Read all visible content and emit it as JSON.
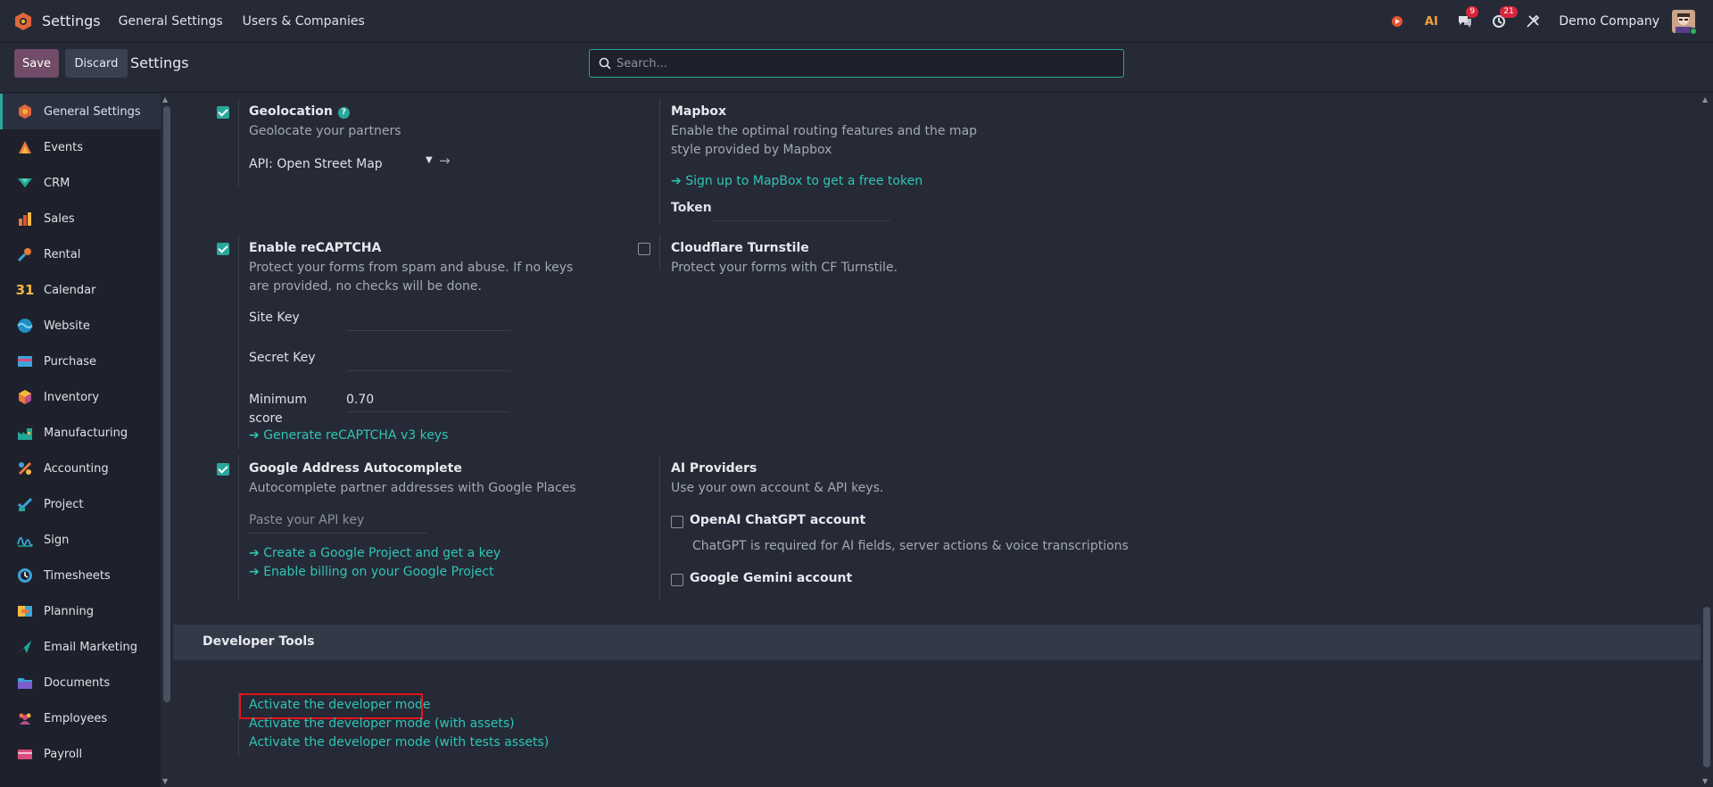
{
  "navbar": {
    "app_name": "Settings",
    "menus": [
      "General Settings",
      "Users & Companies"
    ],
    "ai_label": "AI",
    "messages_count": "9",
    "activities_count": "21",
    "company": "Demo Company"
  },
  "control_panel": {
    "save_label": "Save",
    "discard_label": "Discard",
    "title": "Settings",
    "search_placeholder": "Search..."
  },
  "sidebar": {
    "items": [
      {
        "label": "General Settings",
        "icon": "general-settings-icon",
        "active": true
      },
      {
        "label": "Events",
        "icon": "events-icon"
      },
      {
        "label": "CRM",
        "icon": "crm-icon"
      },
      {
        "label": "Sales",
        "icon": "sales-icon"
      },
      {
        "label": "Rental",
        "icon": "rental-icon"
      },
      {
        "label": "Calendar",
        "icon": "calendar-icon"
      },
      {
        "label": "Website",
        "icon": "website-icon"
      },
      {
        "label": "Purchase",
        "icon": "purchase-icon"
      },
      {
        "label": "Inventory",
        "icon": "inventory-icon"
      },
      {
        "label": "Manufacturing",
        "icon": "manufacturing-icon"
      },
      {
        "label": "Accounting",
        "icon": "accounting-icon"
      },
      {
        "label": "Project",
        "icon": "project-icon"
      },
      {
        "label": "Sign",
        "icon": "sign-icon"
      },
      {
        "label": "Timesheets",
        "icon": "timesheets-icon"
      },
      {
        "label": "Planning",
        "icon": "planning-icon"
      },
      {
        "label": "Email Marketing",
        "icon": "email-marketing-icon"
      },
      {
        "label": "Documents",
        "icon": "documents-icon"
      },
      {
        "label": "Employees",
        "icon": "employees-icon"
      },
      {
        "label": "Payroll",
        "icon": "payroll-icon"
      }
    ]
  },
  "settings": {
    "geolocation": {
      "title": "Geolocation",
      "desc": "Geolocate your partners",
      "api_value": "API: Open Street Map",
      "checked": true
    },
    "mapbox": {
      "title": "Mapbox",
      "desc": "Enable the optimal routing features and the map style provided by Mapbox",
      "link": "Sign up to MapBox to get a free token",
      "token_label": "Token"
    },
    "recaptcha": {
      "title": "Enable reCAPTCHA",
      "desc": "Protect your forms from spam and abuse. If no keys are provided, no checks will be done.",
      "site_key_label": "Site Key",
      "secret_key_label": "Secret Key",
      "min_score_label": "Minimum score",
      "min_score_value": "0.70",
      "link": "Generate reCAPTCHA v3 keys",
      "checked": true
    },
    "turnstile": {
      "title": "Cloudflare Turnstile",
      "desc": "Protect your forms with CF Turnstile.",
      "checked": false
    },
    "google_autocomplete": {
      "title": "Google Address Autocomplete",
      "desc": "Autocomplete partner addresses with Google Places",
      "api_placeholder": "Paste your API key",
      "link1": "Create a Google Project and get a key",
      "link2": "Enable billing on your Google Project",
      "checked": true
    },
    "ai_providers": {
      "title": "AI Providers",
      "desc": "Use your own account & API keys.",
      "openai_label": "OpenAI ChatGPT account",
      "openai_desc": "ChatGPT is required for AI fields, server actions & voice transcriptions",
      "gemini_label": "Google Gemini account"
    }
  },
  "developer_tools": {
    "title": "Developer Tools",
    "links": [
      "Activate the developer mode",
      "Activate the developer mode (with assets)",
      "Activate the developer mode (with tests assets)"
    ]
  },
  "colors": {
    "accent": "#2aa79c",
    "primary": "#714b67",
    "background": "#262a36",
    "highlight": "#e0141f"
  }
}
